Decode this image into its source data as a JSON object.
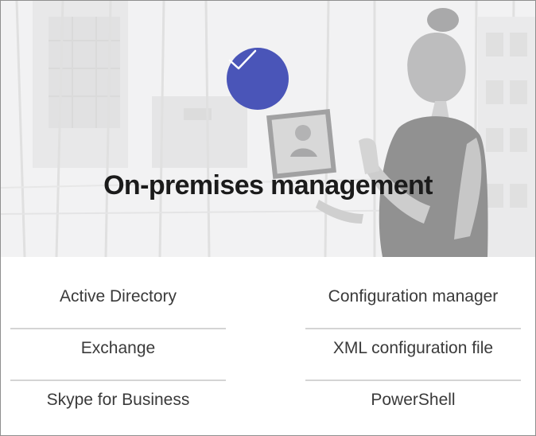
{
  "hero": {
    "title": "On-premises management",
    "badge_icon": "checkmark-icon",
    "badge_color": "#4a55b8"
  },
  "links": {
    "left": [
      {
        "label": "Active Directory"
      },
      {
        "label": "Exchange"
      },
      {
        "label": "Skype for Business"
      }
    ],
    "right": [
      {
        "label": "Configuration manager"
      },
      {
        "label": "XML configuration file"
      },
      {
        "label": "PowerShell"
      }
    ]
  }
}
